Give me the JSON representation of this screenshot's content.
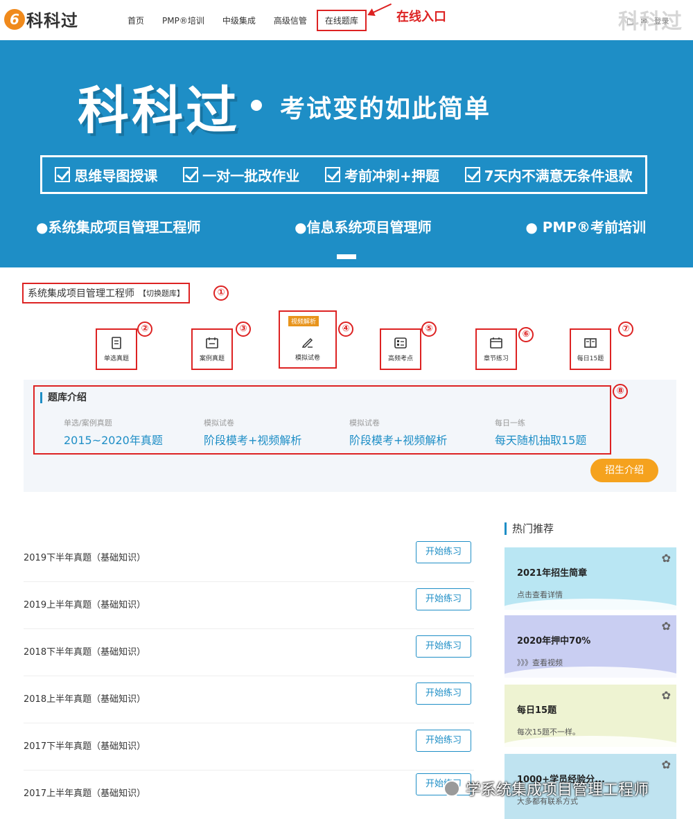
{
  "header": {
    "logo_mark": "6",
    "logo_text": "科科过",
    "nav": [
      "首页",
      "PMP®培训",
      "中级集成",
      "高级信管",
      "在线题库"
    ],
    "nav_annotation": "在线入口",
    "watermark": "科科过",
    "login": "登录"
  },
  "banner": {
    "brand": "科科过",
    "slogan": "考试变的如此简单",
    "features": [
      "思维导图授课",
      "一对一批改作业",
      "考前冲刺+押题",
      "7天内不满意无条件退款"
    ],
    "courses": [
      "●系统集成项目管理工程师",
      "●信息系统项目管理师",
      "● PMP®考前培训"
    ],
    "accent_color": "#1e8ec6"
  },
  "question_bank": {
    "title": "系统集成项目管理工程师",
    "switch": "【切换题库】",
    "categories": [
      {
        "label": "单选真题",
        "icon": "document-icon"
      },
      {
        "label": "案例真题",
        "icon": "calendar-grid-icon"
      },
      {
        "label": "模拟试卷",
        "icon": "pencil-icon",
        "tag": "视频解析"
      },
      {
        "label": "高频考点",
        "icon": "checklist-icon"
      },
      {
        "label": "章节练习",
        "icon": "calendar-icon"
      },
      {
        "label": "每日15题",
        "icon": "open-book-icon"
      }
    ],
    "markers": [
      "①",
      "②",
      "③",
      "④",
      "⑤",
      "⑥",
      "⑦",
      "⑧"
    ]
  },
  "intro": {
    "title": "题库介绍",
    "columns": [
      {
        "caption": "单选/案例真题",
        "value": "2015~2020年真题"
      },
      {
        "caption": "模拟试卷",
        "value": "阶段模考+视频解析"
      },
      {
        "caption": "模拟试卷",
        "value": "阶段模考+视频解析"
      },
      {
        "caption": "每日一练",
        "value": "每天随机抽取15题"
      }
    ],
    "enroll_button": "招生介绍"
  },
  "exams": [
    {
      "name": "2019下半年真题（基础知识）",
      "button": "开始练习"
    },
    {
      "name": "2019上半年真题（基础知识）",
      "button": "开始练习"
    },
    {
      "name": "2018下半年真题（基础知识）",
      "button": "开始练习"
    },
    {
      "name": "2018上半年真题（基础知识）",
      "button": "开始练习"
    },
    {
      "name": "2017下半年真题（基础知识）",
      "button": "开始练习"
    },
    {
      "name": "2017上半年真题（基础知识）",
      "button": "开始练习"
    }
  ],
  "hot": {
    "title": "热门推荐",
    "cards": [
      {
        "title": "2021年招生简章",
        "sub": "点击查看详情",
        "color": "#b9e6f3"
      },
      {
        "title": "2020年押中70%",
        "sub": "》》》查看视频",
        "color": "#c9cef2"
      },
      {
        "title": "每日15题",
        "sub": "每次15题不一样。",
        "color": "#eef3d2"
      },
      {
        "title": "1000+学员经验分...",
        "sub": "大多都有联系方式",
        "color": "#bfe3f0"
      }
    ]
  },
  "footer_watermark": "学系统集成项目管理工程师"
}
